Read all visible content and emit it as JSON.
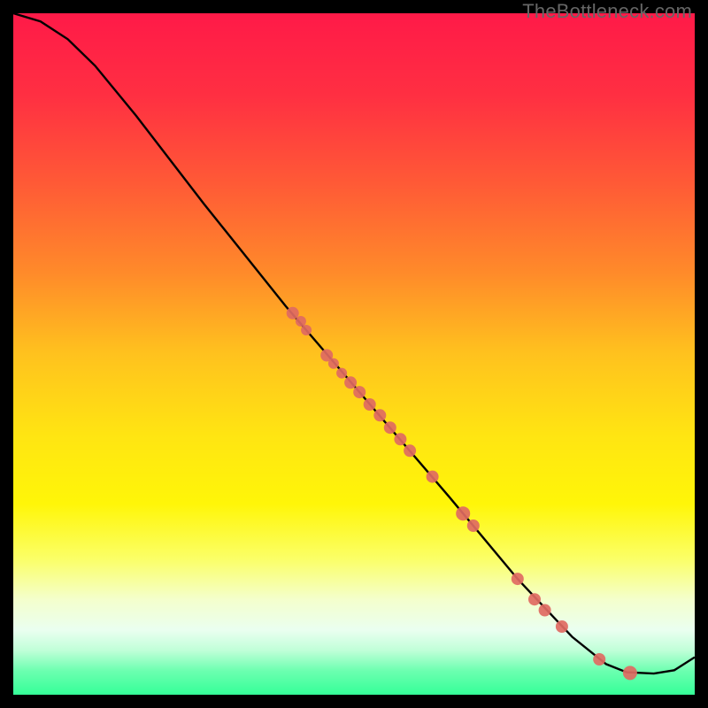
{
  "watermark": "TheBottleneck.com",
  "chart_data": {
    "type": "line",
    "title": "",
    "xlabel": "",
    "ylabel": "",
    "xlim": [
      0,
      100
    ],
    "ylim": [
      0,
      100
    ],
    "gradient_stops": [
      {
        "offset": 0.0,
        "color": "#ff1a48"
      },
      {
        "offset": 0.12,
        "color": "#ff2f42"
      },
      {
        "offset": 0.25,
        "color": "#ff5a36"
      },
      {
        "offset": 0.38,
        "color": "#ff8a2a"
      },
      {
        "offset": 0.5,
        "color": "#ffc21e"
      },
      {
        "offset": 0.62,
        "color": "#ffe512"
      },
      {
        "offset": 0.72,
        "color": "#fff608"
      },
      {
        "offset": 0.8,
        "color": "#fbff66"
      },
      {
        "offset": 0.86,
        "color": "#f4ffcc"
      },
      {
        "offset": 0.905,
        "color": "#eafff0"
      },
      {
        "offset": 0.935,
        "color": "#c0ffd8"
      },
      {
        "offset": 0.965,
        "color": "#6cffb0"
      },
      {
        "offset": 1.0,
        "color": "#35ff98"
      }
    ],
    "series": [
      {
        "name": "curve",
        "points": [
          {
            "x": 0.0,
            "y": 100.0
          },
          {
            "x": 4.0,
            "y": 98.8
          },
          {
            "x": 8.0,
            "y": 96.2
          },
          {
            "x": 12.0,
            "y": 92.3
          },
          {
            "x": 18.0,
            "y": 85.0
          },
          {
            "x": 28.0,
            "y": 72.0
          },
          {
            "x": 40.0,
            "y": 57.0
          },
          {
            "x": 52.0,
            "y": 43.0
          },
          {
            "x": 64.0,
            "y": 29.0
          },
          {
            "x": 74.0,
            "y": 17.0
          },
          {
            "x": 82.0,
            "y": 8.5
          },
          {
            "x": 87.0,
            "y": 4.5
          },
          {
            "x": 90.0,
            "y": 3.3
          },
          {
            "x": 94.0,
            "y": 3.1
          },
          {
            "x": 97.0,
            "y": 3.6
          },
          {
            "x": 100.0,
            "y": 5.5
          }
        ]
      }
    ],
    "scatter": {
      "name": "dots",
      "color": "#e06a62",
      "points": [
        {
          "x": 41.0,
          "y": 56.0,
          "r": 7
        },
        {
          "x": 42.2,
          "y": 54.8,
          "r": 6
        },
        {
          "x": 43.0,
          "y": 53.5,
          "r": 6
        },
        {
          "x": 46.0,
          "y": 49.8,
          "r": 7
        },
        {
          "x": 47.0,
          "y": 48.6,
          "r": 6
        },
        {
          "x": 48.2,
          "y": 47.2,
          "r": 6
        },
        {
          "x": 49.5,
          "y": 45.8,
          "r": 7
        },
        {
          "x": 50.8,
          "y": 44.4,
          "r": 7
        },
        {
          "x": 52.3,
          "y": 42.6,
          "r": 7
        },
        {
          "x": 53.8,
          "y": 41.0,
          "r": 7
        },
        {
          "x": 55.3,
          "y": 39.2,
          "r": 7
        },
        {
          "x": 56.8,
          "y": 37.5,
          "r": 7
        },
        {
          "x": 58.2,
          "y": 35.8,
          "r": 7
        },
        {
          "x": 61.5,
          "y": 32.0,
          "r": 7
        },
        {
          "x": 66.0,
          "y": 26.6,
          "r": 8
        },
        {
          "x": 67.5,
          "y": 24.8,
          "r": 7
        },
        {
          "x": 74.0,
          "y": 17.0,
          "r": 7
        },
        {
          "x": 76.5,
          "y": 14.0,
          "r": 7
        },
        {
          "x": 78.0,
          "y": 12.4,
          "r": 7
        },
        {
          "x": 80.5,
          "y": 10.0,
          "r": 7
        },
        {
          "x": 86.0,
          "y": 5.2,
          "r": 7
        },
        {
          "x": 90.5,
          "y": 3.2,
          "r": 8
        }
      ]
    }
  }
}
